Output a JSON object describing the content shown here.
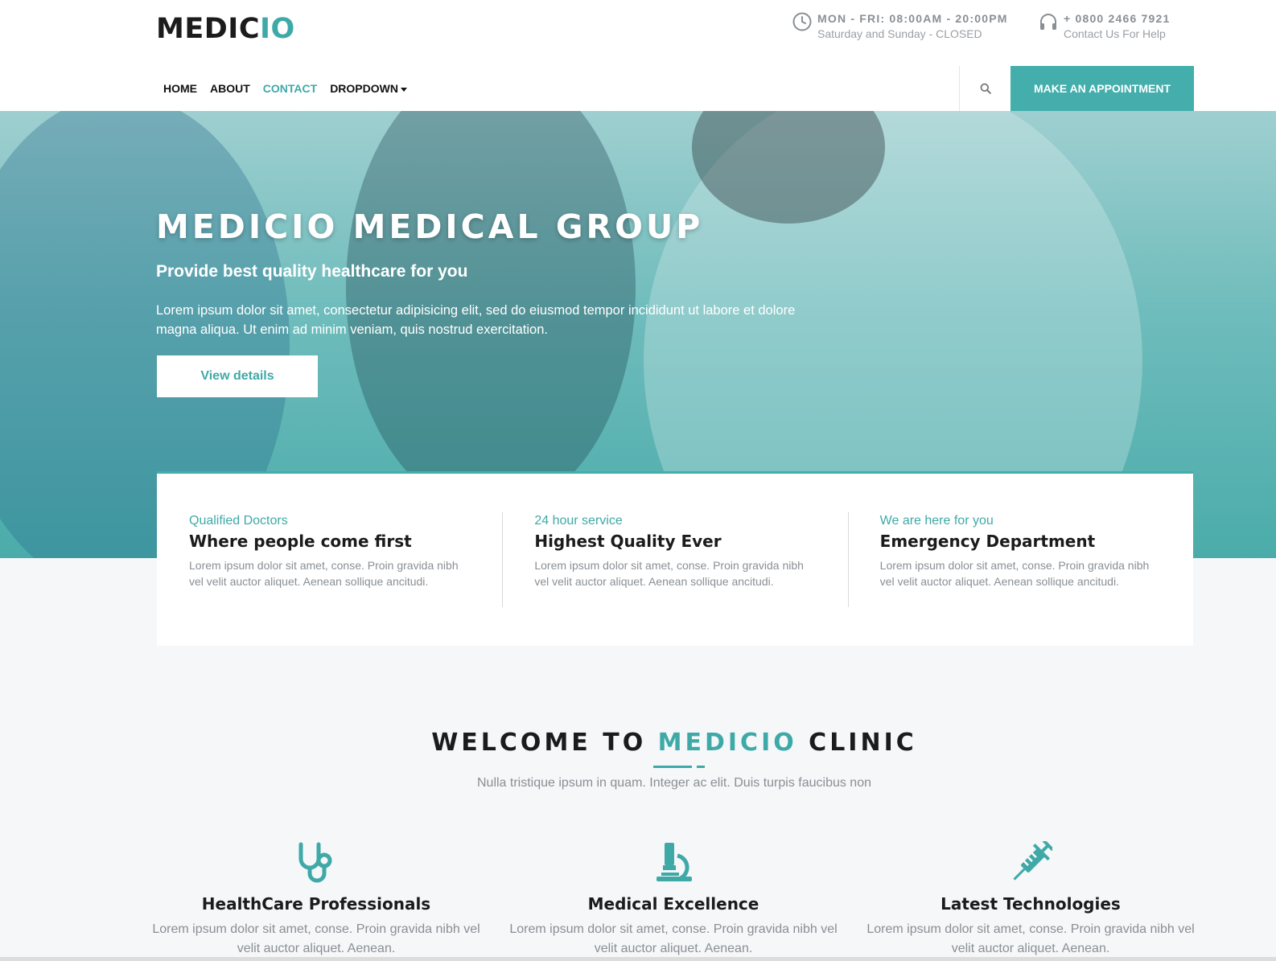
{
  "brand": {
    "logo_main": "MEDIC",
    "logo_accent": "IO",
    "accent_color": "#3fa9a7"
  },
  "topbar": {
    "hours_title": "MON - FRI: 08:00AM - 20:00PM",
    "hours_sub": "Saturday and Sunday - CLOSED",
    "phone_title": "+ 0800 2466 7921",
    "phone_sub": "Contact Us For Help"
  },
  "nav": {
    "items": [
      {
        "label": "HOME"
      },
      {
        "label": "ABOUT"
      },
      {
        "label": "CONTACT",
        "active": true
      },
      {
        "label": "DROPDOWN"
      }
    ],
    "search_icon": "search-icon",
    "appointment_label": "MAKE AN APPOINTMENT"
  },
  "hero": {
    "title": "MEDICIO MEDICAL GROUP",
    "subtitle": "Provide best quality healthcare for you",
    "text": "Lorem ipsum dolor sit amet, consectetur adipisicing elit, sed do eiusmod tempor incididunt ut labore et dolore magna aliqua. Ut enim ad minim veniam, quis nostrud exercitation.",
    "button": "View details"
  },
  "features": [
    {
      "kicker": "Qualified Doctors",
      "title": "Where people come first",
      "text": "Lorem ipsum dolor sit amet, conse. Proin gravida nibh vel velit auctor aliquet. Aenean sollique ancitudi."
    },
    {
      "kicker": "24 hour service",
      "title": "Highest Quality Ever",
      "text": "Lorem ipsum dolor sit amet, conse. Proin gravida nibh vel velit auctor aliquet. Aenean sollique ancitudi."
    },
    {
      "kicker": "We are here for you",
      "title": "Emergency Department",
      "text": "Lorem ipsum dolor sit amet, conse. Proin gravida nibh vel velit auctor aliquet. Aenean sollique ancitudi."
    }
  ],
  "welcome": {
    "title_pre": "WELCOME TO ",
    "title_accent": "MEDICIO",
    "title_post": " CLINIC",
    "subtitle": "Nulla tristique ipsum in quam. Integer ac elit. Duis turpis faucibus non"
  },
  "services": [
    {
      "icon": "stethoscope-icon",
      "title": "HealthCare Professionals",
      "text": "Lorem ipsum dolor sit amet, conse. Proin gravida nibh vel velit auctor aliquet. Aenean."
    },
    {
      "icon": "microscope-icon",
      "title": "Medical Excellence",
      "text": "Lorem ipsum dolor sit amet, conse. Proin gravida nibh vel velit auctor aliquet. Aenean."
    },
    {
      "icon": "syringe-icon",
      "title": "Latest Technologies",
      "text": "Lorem ipsum dolor sit amet, conse. Proin gravida nibh vel velit auctor aliquet. Aenean."
    }
  ]
}
